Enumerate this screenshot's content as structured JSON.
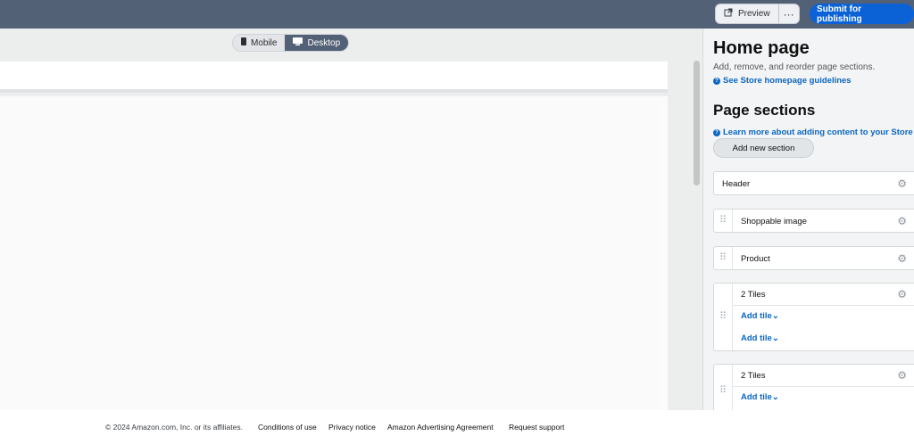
{
  "topbar": {
    "preview_label": "Preview",
    "more_label": "···",
    "submit_label": "Submit for publishing"
  },
  "device_toggle": {
    "mobile_label": "Mobile",
    "desktop_label": "Desktop",
    "selected": "Desktop"
  },
  "panel": {
    "title": "Home page",
    "subtitle": "Add, remove, and reorder page sections.",
    "guidelines_link": "See Store homepage guidelines",
    "sections_title": "Page sections",
    "learn_link": "Learn more about adding content to your Store",
    "add_section_label": "Add new section",
    "sections": [
      {
        "label": "Header"
      },
      {
        "label": "Shoppable image"
      },
      {
        "label": "Product"
      },
      {
        "label": "2 Tiles",
        "tiles": [
          "Add tile",
          "Add tile"
        ]
      },
      {
        "label": "2 Tiles",
        "tiles": [
          "Add tile"
        ]
      }
    ]
  },
  "footer": {
    "copyright": "© 2024 Amazon.com, Inc. or its affiliates.",
    "links": [
      "Conditions of use",
      "Privacy notice",
      "Amazon Advertising Agreement",
      "Request support"
    ]
  },
  "colors": {
    "topbar": "#536177",
    "primary_button": "#0b62d6",
    "link": "#0a66c2",
    "panel_bg": "#f3f4f5"
  },
  "icons": {
    "preview": "external-link-icon",
    "mobile": "phone-icon",
    "desktop": "monitor-icon",
    "help": "question-circle-icon",
    "settings": "gear-icon",
    "drag": "drag-handle-icon",
    "chevron": "chevron-down-icon"
  }
}
